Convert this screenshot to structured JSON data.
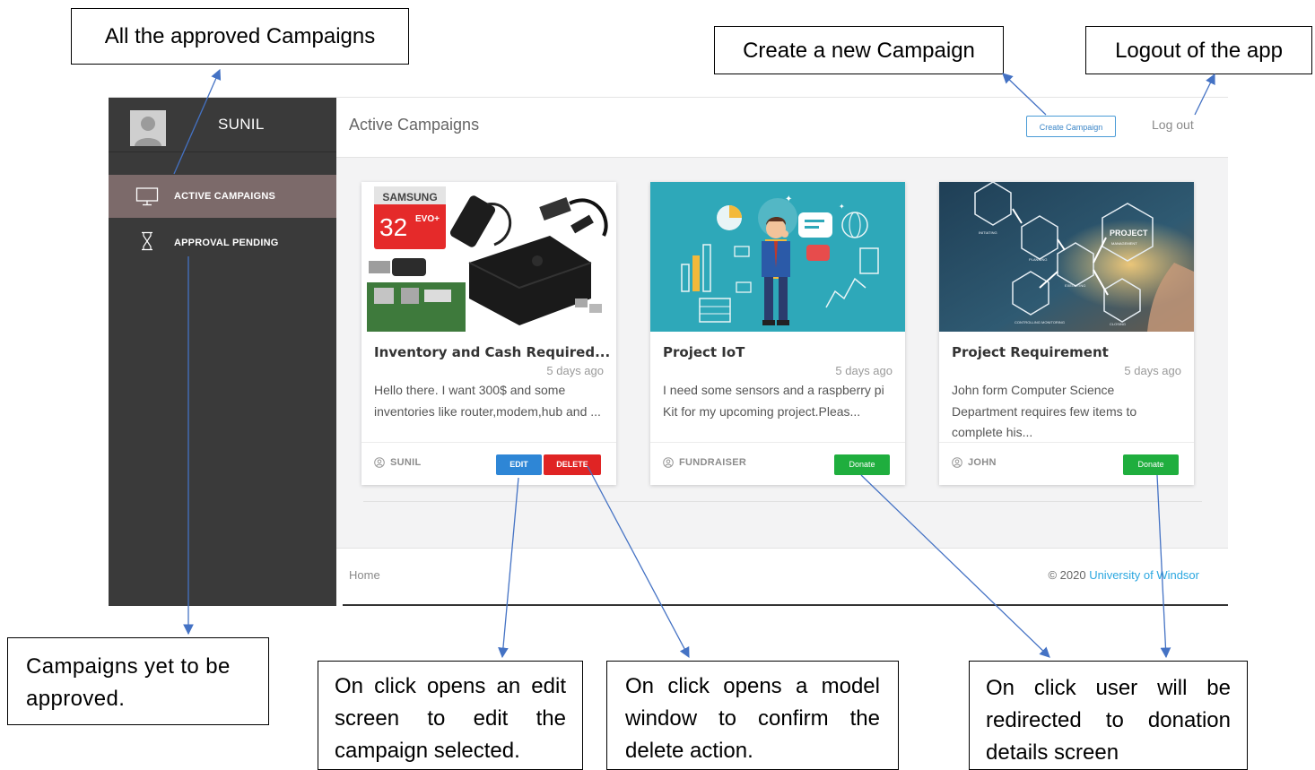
{
  "app": {
    "user_name": "SUNIL",
    "page_title": "Active Campaigns",
    "create_button": "Create Campaign",
    "logout": "Log out"
  },
  "sidebar": {
    "items": [
      {
        "label": "ACTIVE CAMPAIGNS",
        "icon": "monitor-icon",
        "active": true
      },
      {
        "label": "APPROVAL PENDING",
        "icon": "hourglass-icon",
        "active": false
      }
    ]
  },
  "cards": [
    {
      "title": "Inventory and Cash Required...",
      "time": "5 days ago",
      "description": "Hello there. I want 300$ and some inventories like router,modem,hub and ...",
      "owner": "SUNIL",
      "edit_label": "EDIT",
      "delete_label": "DELETE"
    },
    {
      "title": "Project IoT",
      "time": "5 days ago",
      "description": "I need some sensors and a raspberry pi Kit for my upcoming project.Pleas...",
      "owner": "FUNDRAISER",
      "donate_label": "Donate"
    },
    {
      "title": "Project Requirement",
      "time": "5 days ago",
      "description": "John form Computer Science Department requires few items to complete his...",
      "owner": "JOHN",
      "donate_label": "Donate"
    }
  ],
  "card_images": {
    "card1": {
      "brand": "SAMSUNG",
      "capacity": "32",
      "badge": "EVO+"
    },
    "card3": {
      "label": "PROJECT",
      "sub": "MANAGEMENT",
      "steps": [
        "INITIATING",
        "PLANNING",
        "EXECUTING",
        "CONTROLLING MONITORING",
        "CLOSING"
      ]
    }
  },
  "footer": {
    "home": "Home",
    "copyright": "© 2020 ",
    "link": "University of Windsor"
  },
  "annotations": {
    "approved": "All the approved Campaigns",
    "create": "Create a new Campaign",
    "logout": "Logout of the app",
    "pending": "Campaigns yet to be approved.",
    "edit": "On click opens an edit screen to edit the campaign selected.",
    "delete": "On click opens a model window to confirm the delete action.",
    "donate": "On click user will be redirected to donation details screen"
  },
  "colors": {
    "sidebar": "#3a3a3a",
    "sidebar_active": "#7c6a6a",
    "edit": "#2e86d6",
    "delete": "#e02424",
    "donate": "#1fae3e",
    "link": "#2ba7e0",
    "arrow": "#4472c4"
  }
}
